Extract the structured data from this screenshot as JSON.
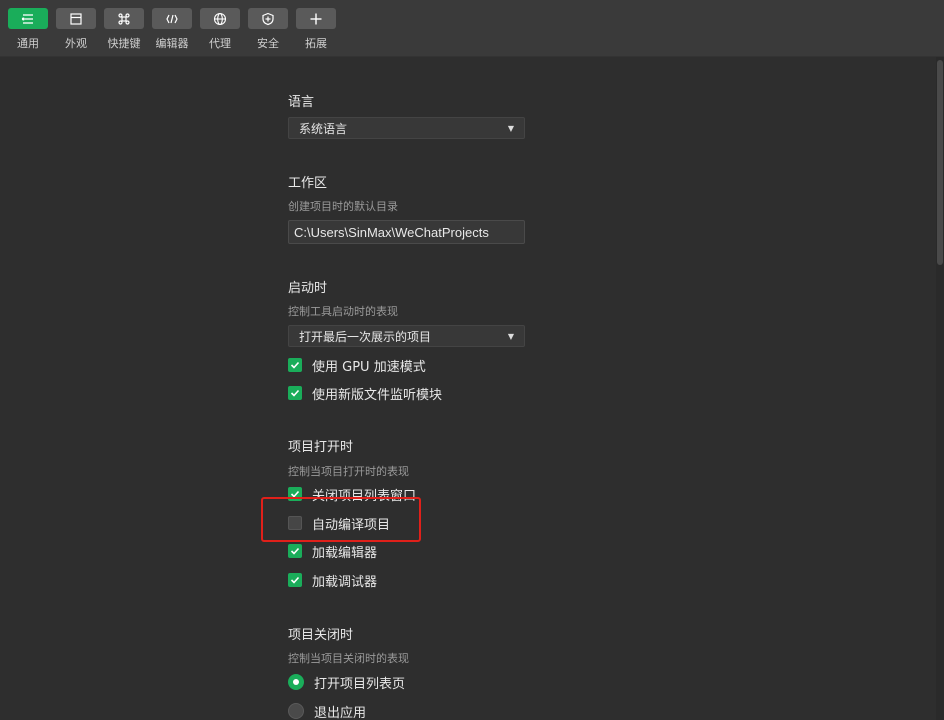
{
  "toolbar": {
    "items": [
      {
        "label": "通用",
        "icon": "general-list-icon",
        "active": true
      },
      {
        "label": "外观",
        "icon": "appearance-window-icon",
        "active": false
      },
      {
        "label": "快捷键",
        "icon": "command-key-icon",
        "active": false
      },
      {
        "label": "编辑器",
        "icon": "code-brackets-icon",
        "active": false
      },
      {
        "label": "代理",
        "icon": "globe-icon",
        "active": false
      },
      {
        "label": "安全",
        "icon": "shield-icon",
        "active": false
      },
      {
        "label": "拓展",
        "icon": "plus-icon",
        "active": false
      }
    ],
    "accent": "#1aad5a"
  },
  "settings": {
    "language": {
      "title": "语言",
      "selected": "系统语言"
    },
    "workspace": {
      "title": "工作区",
      "desc": "创建项目时的默认目录",
      "path": "C:\\Users\\SinMax\\WeChatProjects"
    },
    "startup": {
      "title": "启动时",
      "desc": "控制工具启动时的表现",
      "selected": "打开最后一次展示的项目",
      "options": [
        {
          "label": "使用 GPU 加速模式",
          "checked": true
        },
        {
          "label": "使用新版文件监听模块",
          "checked": true
        }
      ]
    },
    "project_open": {
      "title": "项目打开时",
      "desc": "控制当项目打开时的表现",
      "options": [
        {
          "label": "关闭项目列表窗口",
          "checked": true
        },
        {
          "label": "自动编译项目",
          "checked": false
        },
        {
          "label": "加载编辑器",
          "checked": true
        },
        {
          "label": "加载调试器",
          "checked": true
        }
      ]
    },
    "project_close": {
      "title": "项目关闭时",
      "desc": "控制当项目关闭时的表现",
      "options": [
        {
          "label": "打开项目列表页",
          "selected": true
        },
        {
          "label": "退出应用",
          "selected": false
        }
      ]
    }
  },
  "highlight_color": "#e0201a"
}
